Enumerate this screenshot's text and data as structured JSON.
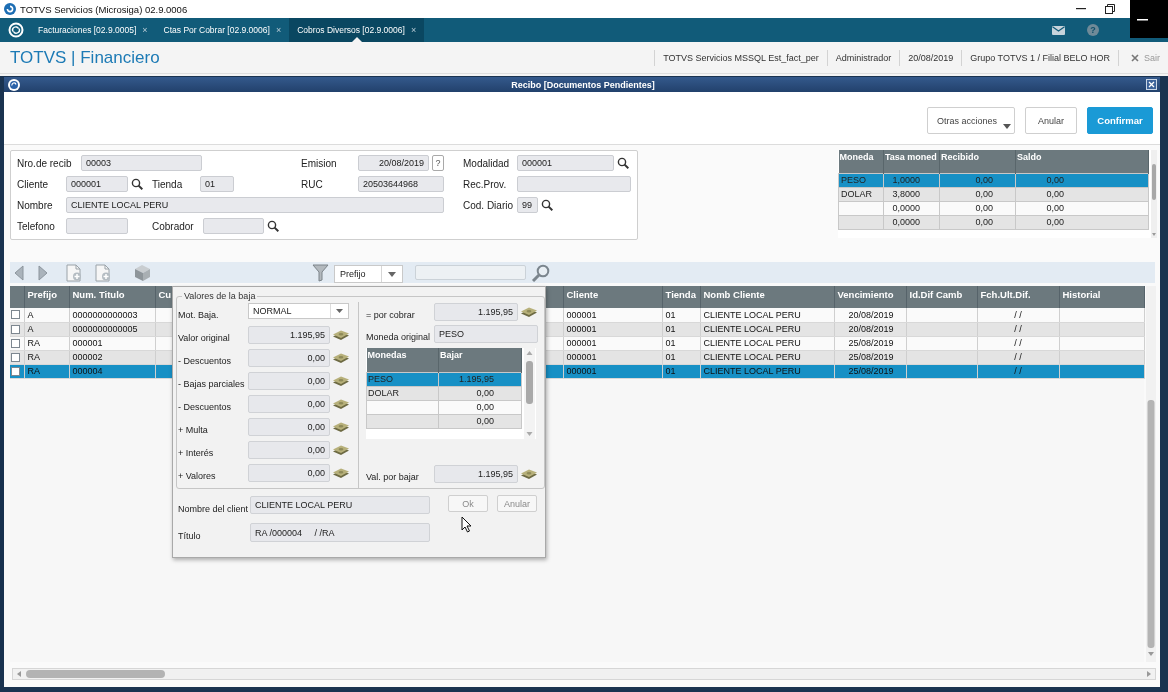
{
  "app_window": {
    "title": "TOTVS Servicios (Microsiga) 02.9.0006"
  },
  "tab_bar": {
    "tabs": [
      {
        "label": "Facturaciones [02.9.0005]",
        "close": "×",
        "selected": false
      },
      {
        "label": "Ctas Por Cobrar [02.9.0006]",
        "close": "×",
        "selected": false
      },
      {
        "label": "Cobros Diversos [02.9.0006]",
        "close": "×",
        "selected": true
      }
    ],
    "help": "?"
  },
  "header": {
    "brand": "TOTVS | Financiero",
    "info": [
      "TOTVS Servicios MSSQL Est_fact_per",
      "Administrador",
      "20/08/2019",
      "Grupo TOTVS 1 / Filial BELO HOR"
    ],
    "logout": "Sair"
  },
  "window": {
    "title": "Recibo [Documentos Pendientes]",
    "actions": [
      {
        "label": "Otras acciones",
        "kind": "menu"
      },
      {
        "label": "Anular",
        "kind": "plain"
      },
      {
        "label": "Confirmar",
        "kind": "primary"
      }
    ]
  },
  "receipt_form": {
    "nro_recib": {
      "label": "Nro.de recib",
      "value": "00003"
    },
    "emision": {
      "label": "Emision",
      "value": "20/08/2019",
      "help": "?"
    },
    "modalidad": {
      "label": "Modalidad",
      "value": "000001"
    },
    "cliente": {
      "label": "Cliente",
      "value": "000001"
    },
    "tienda": {
      "label": "Tienda",
      "value": "01"
    },
    "ruc": {
      "label": "RUC",
      "value": "20503644968"
    },
    "rec_prov": {
      "label": "Rec.Prov."
    },
    "nombre": {
      "label": "Nombre",
      "value": "CLIENTE LOCAL PERU"
    },
    "cod_diario": {
      "label": "Cod. Diario",
      "value": "99"
    },
    "telefono": {
      "label": "Telefono"
    },
    "cobrador": {
      "label": "Cobrador"
    }
  },
  "currency_table": {
    "columns": [
      "Moneda",
      "Tasa moned",
      "Recibido",
      "Saldo"
    ],
    "rows": [
      {
        "cells": [
          "PESO",
          "1,0000",
          "0,00",
          "0,00"
        ],
        "selected": true
      },
      {
        "cells": [
          "DOLAR",
          "3,8000",
          "0,00",
          "0,00"
        ],
        "selected": false
      },
      {
        "cells": [
          null,
          "0,0000",
          "0,00",
          "0,00"
        ],
        "selected": false
      },
      {
        "cells": [
          null,
          "0,0000",
          "0,00",
          "0,00"
        ],
        "selected": false
      }
    ]
  },
  "browse_toolbar": {
    "filter_field": {
      "value": "Prefijo"
    }
  },
  "titles_table": {
    "columns": [
      "Prefijo",
      "Num. Titulo",
      "Cu",
      "Cliente",
      "Tienda",
      "Nomb Cliente",
      "Vencimiento",
      "Id.Dif Camb",
      "Fch.Ult.Dif.",
      "Historial"
    ],
    "rows": [
      {
        "checked": false,
        "selected": false,
        "cells": [
          "A",
          "0000000000003",
          null,
          "000001",
          "01",
          "CLIENTE LOCAL PERU",
          "20/08/2019",
          null,
          "/ /",
          null
        ]
      },
      {
        "checked": false,
        "selected": false,
        "cells": [
          "A",
          "0000000000005",
          null,
          "000001",
          "01",
          "CLIENTE LOCAL PERU",
          "20/08/2019",
          null,
          "/ /",
          null
        ]
      },
      {
        "checked": false,
        "selected": false,
        "cells": [
          "RA",
          "000001",
          null,
          "000001",
          "01",
          "CLIENTE LOCAL PERU",
          "25/08/2019",
          null,
          "/ /",
          null
        ]
      },
      {
        "checked": false,
        "selected": false,
        "cells": [
          "RA",
          "000002",
          null,
          "000001",
          "01",
          "CLIENTE LOCAL PERU",
          "25/08/2019",
          null,
          "/ /",
          null
        ]
      },
      {
        "checked": false,
        "selected": true,
        "cells": [
          "RA",
          "000004",
          null,
          "000001",
          "01",
          "CLIENTE LOCAL PERU",
          "25/08/2019",
          null,
          "/ /",
          null
        ]
      }
    ]
  },
  "baja_dialog": {
    "group_title": "Valores de la baja",
    "mot_baja": {
      "label": "Mot. Baja.",
      "value": "NORMAL"
    },
    "amounts": [
      {
        "label": "Valor original",
        "value": "1.195,95"
      },
      {
        "label": "- Descuentos",
        "value": "0,00"
      },
      {
        "label": "- Bajas parciales",
        "value": "0,00"
      },
      {
        "label": "- Descuentos",
        "value": "0,00"
      },
      {
        "label": "+ Multa",
        "value": "0,00"
      },
      {
        "label": "+ Interés",
        "value": "0,00"
      },
      {
        "label": "+ Valores",
        "value": "0,00"
      }
    ],
    "por_cobrar": {
      "label": "= por cobrar",
      "value": "1.195,95"
    },
    "moneda_original": {
      "label": "Moneda original",
      "value": "PESO"
    },
    "currencies": {
      "columns": [
        "Monedas",
        "Bajar"
      ],
      "rows": [
        {
          "cells": [
            "PESO",
            "1.195,95"
          ],
          "selected": true
        },
        {
          "cells": [
            "DOLAR",
            "0,00"
          ],
          "selected": false
        },
        {
          "cells": [
            null,
            "0,00"
          ],
          "selected": false
        },
        {
          "cells": [
            null,
            "0,00"
          ],
          "selected": false
        }
      ]
    },
    "val_por_bajar": {
      "label": "Val. por bajar",
      "value": "1.195,95"
    },
    "cliente": {
      "label": "Nombre del client",
      "value": "CLIENTE LOCAL PERU"
    },
    "titulo": {
      "label": "Título",
      "value": "RA /000004     / /RA"
    },
    "buttons": [
      "Ok",
      "Anular"
    ]
  }
}
